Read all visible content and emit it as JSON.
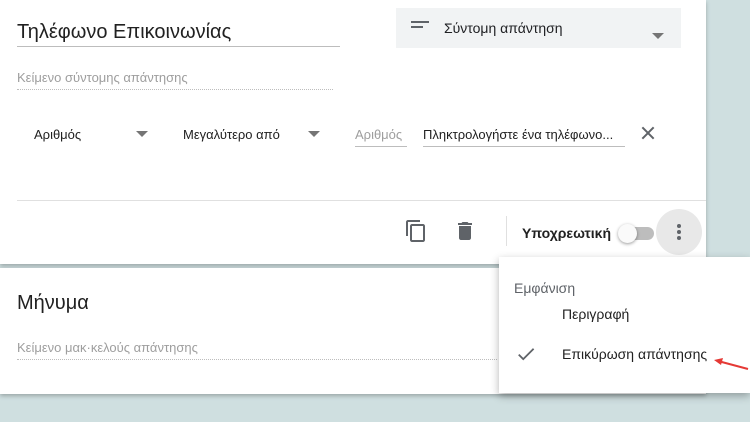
{
  "question1": {
    "title": "Τηλέφωνο Επικοινωνίας",
    "type_label": "Σύντομη απάντηση",
    "answer_placeholder": "Κείμενο σύντομης απάντησης",
    "validation": {
      "kind": "Αριθμός",
      "condition": "Μεγαλύτερο από",
      "number_placeholder": "Αριθμός",
      "error_text": "Πληκτρολογήστε ένα τηλέφωνο..."
    },
    "required_label": "Υποχρεωτική",
    "required_on": false
  },
  "question2": {
    "title": "Μήνυμα",
    "answer_placeholder": "Κείμενο μακ·κελούς απάντησης"
  },
  "menu": {
    "header": "Εμφάνιση",
    "items": [
      {
        "label": "Περιγραφή",
        "checked": false
      },
      {
        "label": "Επικύρωση απάντησης",
        "checked": true
      }
    ]
  },
  "colors": {
    "background": "#cfdfe0",
    "annotation_arrow": "#e53935"
  }
}
